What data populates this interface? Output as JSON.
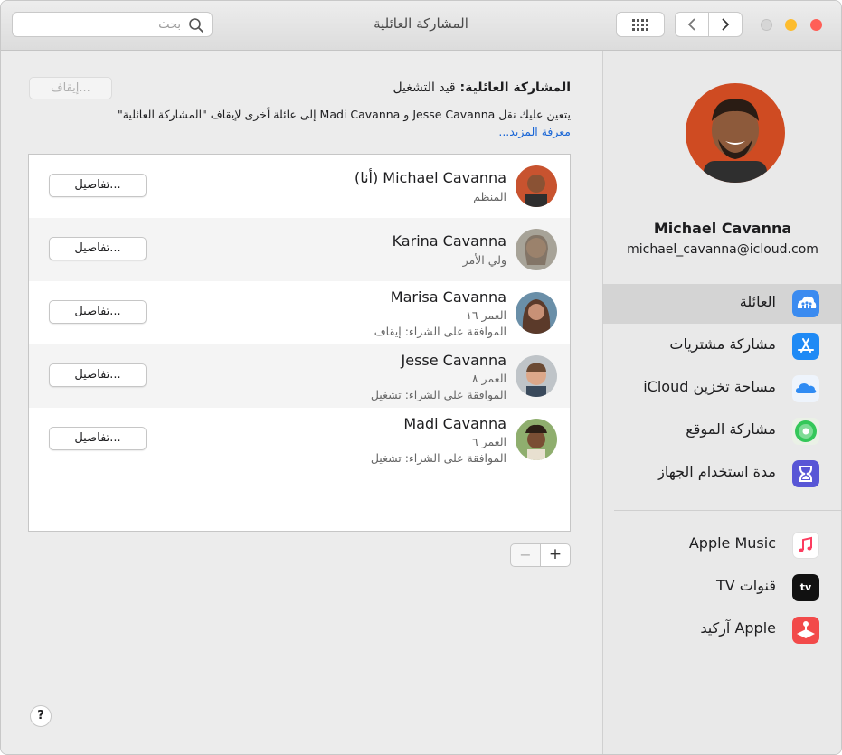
{
  "window": {
    "title": "المشاركة العائلية"
  },
  "search": {
    "placeholder": "بحث"
  },
  "toolbar": {
    "back_icon": "chevron-left-icon",
    "forward_icon": "chevron-right-icon",
    "grid_icon": "grid-icon"
  },
  "family_status": {
    "label": "المشاركة العائلية:",
    "value": "قيد التشغيل",
    "stop_label": "إيقاف...",
    "description": "يتعين عليك نقل Jesse Cavanna و Madi Cavanna إلى عائلة أخرى لإيقاف \"المشاركة العائلية\"",
    "learn_more": "معرفة المزيد..."
  },
  "members": [
    {
      "name": "Michael Cavanna (أنا)",
      "role": "المنظم",
      "purchase": "",
      "details_label": "تفاصيل..."
    },
    {
      "name": "Karina Cavanna",
      "role": "ولي الأمر",
      "purchase": "",
      "details_label": "تفاصيل..."
    },
    {
      "name": "Marisa Cavanna",
      "role": "العمر ١٦",
      "purchase": "الموافقة على الشراء: إيقاف",
      "details_label": "تفاصيل..."
    },
    {
      "name": "Jesse Cavanna",
      "role": "العمر ٨",
      "purchase": "الموافقة على الشراء: تشغيل",
      "details_label": "تفاصيل..."
    },
    {
      "name": "Madi Cavanna",
      "role": "العمر ٦",
      "purchase": "الموافقة على الشراء: تشغيل",
      "details_label": "تفاصيل..."
    }
  ],
  "list_controls": {
    "add": "+",
    "remove": "−"
  },
  "help": {
    "label": "?"
  },
  "profile": {
    "name": "Michael Cavanna",
    "email": "michael_cavanna@icloud.com"
  },
  "nav": [
    {
      "label": "العائلة",
      "icon": "family-icon",
      "selected": true,
      "color": "#3b8bf0"
    },
    {
      "label": "مشاركة مشتريات",
      "icon": "app-store-icon",
      "selected": false,
      "color": "#1f8af5"
    },
    {
      "label": "مساحة تخزين iCloud",
      "icon": "icloud-icon",
      "selected": false,
      "color": "#2f8bf3"
    },
    {
      "label": "مشاركة الموقع",
      "icon": "find-my-icon",
      "selected": false,
      "color": "#34c759"
    },
    {
      "label": "مدة استخدام الجهاز",
      "icon": "screen-time-icon",
      "selected": false,
      "color": "#5856d6"
    }
  ],
  "nav2": [
    {
      "label": "Apple Music",
      "icon": "music-icon",
      "color": "#fc3c5f"
    },
    {
      "label": "قنوات TV",
      "icon": "tv-icon",
      "color": "#111111",
      "icon_text": "tv"
    },
    {
      "label": "Apple آركيد",
      "icon": "arcade-icon",
      "color": "#f24a4a"
    }
  ]
}
